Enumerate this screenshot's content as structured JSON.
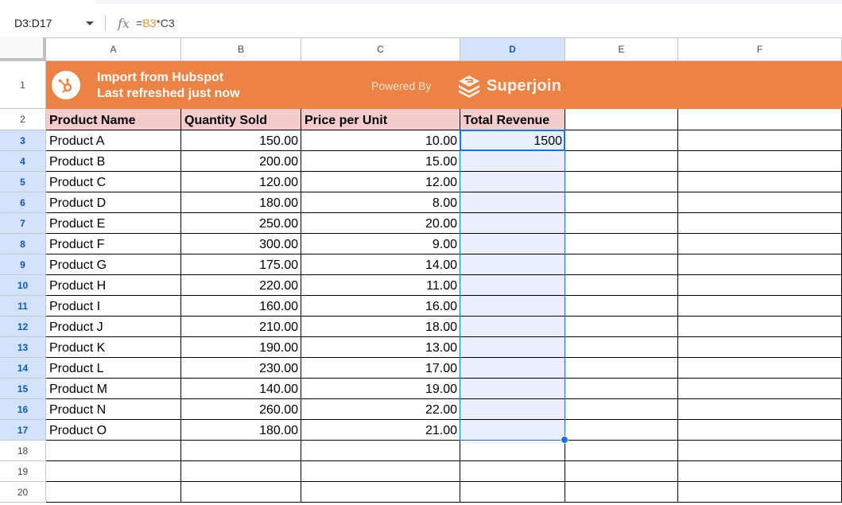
{
  "formula_bar": {
    "name_box": "D3:D17",
    "fx_icon": "fx-icon",
    "formula_prefix": "=",
    "formula_ref1": "B3",
    "formula_op": "*",
    "formula_ref2": "C3"
  },
  "columns": [
    "A",
    "B",
    "C",
    "D",
    "E",
    "F"
  ],
  "selected_column": "D",
  "rows": [
    "1",
    "2",
    "3",
    "4",
    "5",
    "6",
    "7",
    "8",
    "9",
    "10",
    "11",
    "12",
    "13",
    "14",
    "15",
    "16",
    "17",
    "18",
    "19",
    "20"
  ],
  "selected_rows": [
    "3",
    "4",
    "5",
    "6",
    "7",
    "8",
    "9",
    "10",
    "11",
    "12",
    "13",
    "14",
    "15",
    "16",
    "17"
  ],
  "banner": {
    "title_line1": "Import from Hubspot",
    "title_line2": "Last refreshed just now",
    "powered_by": "Powered By",
    "brand": "Superjoin",
    "hubspot_icon": "hubspot-logo-icon",
    "superjoin_icon": "superjoin-logo-icon",
    "color": "#ec8244"
  },
  "table": {
    "headers": [
      "Product Name",
      "Quantity Sold",
      "Price per Unit",
      "Total Revenue"
    ],
    "rows": [
      [
        "Product A",
        "150.00",
        "10.00",
        "1500"
      ],
      [
        "Product B",
        "200.00",
        "15.00",
        ""
      ],
      [
        "Product C",
        "120.00",
        "12.00",
        ""
      ],
      [
        "Product D",
        "180.00",
        "8.00",
        ""
      ],
      [
        "Product E",
        "250.00",
        "20.00",
        ""
      ],
      [
        "Product F",
        "300.00",
        "9.00",
        ""
      ],
      [
        "Product G",
        "175.00",
        "14.00",
        ""
      ],
      [
        "Product H",
        "220.00",
        "11.00",
        ""
      ],
      [
        "Product I",
        "160.00",
        "16.00",
        ""
      ],
      [
        "Product J",
        "210.00",
        "18.00",
        ""
      ],
      [
        "Product K",
        "190.00",
        "13.00",
        ""
      ],
      [
        "Product L",
        "230.00",
        "17.00",
        ""
      ],
      [
        "Product M",
        "140.00",
        "19.00",
        ""
      ],
      [
        "Product N",
        "260.00",
        "22.00",
        ""
      ],
      [
        "Product O",
        "180.00",
        "21.00",
        ""
      ]
    ]
  },
  "colors": {
    "header_fill": "#f4cccc",
    "selection": "#1a73e8",
    "selection_fill": "#e8f0fe"
  }
}
